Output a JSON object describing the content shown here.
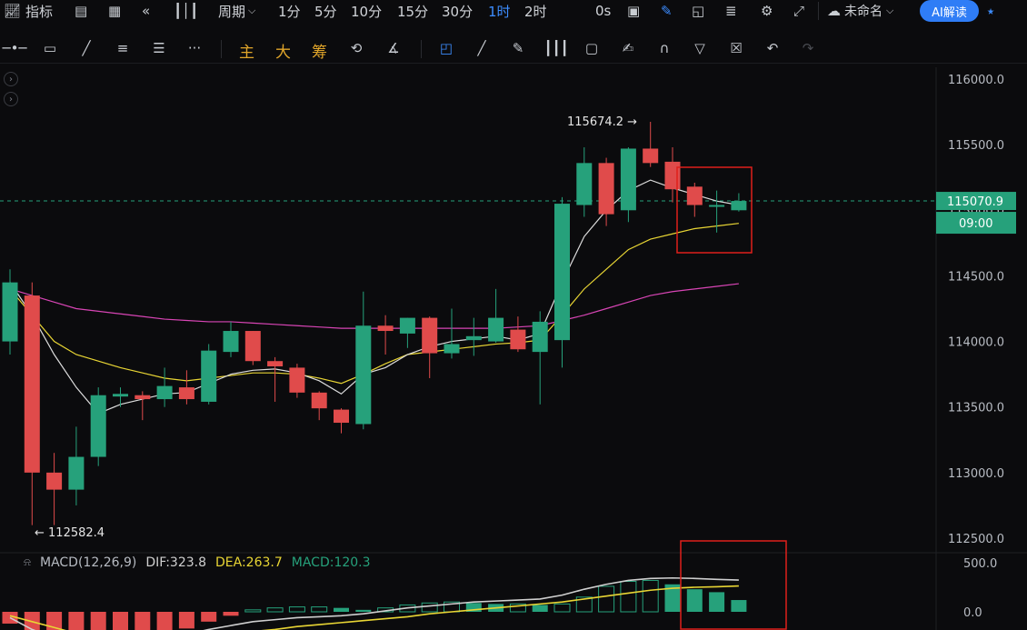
{
  "top_toolbar": {
    "indicators_label": "指标",
    "period_label": "周期",
    "intervals": [
      "1分",
      "5分",
      "10分",
      "15分",
      "30分",
      "1时",
      "2时"
    ],
    "active_interval": "1时",
    "countdown": "0s",
    "layout_name": "未命名",
    "ai_button": "AI解读"
  },
  "draw_toolbar": {
    "overlay_buttons": [
      "主",
      "大",
      "筹"
    ]
  },
  "price_panel": {
    "current_price": "115070.9",
    "countdown_time": "09:00",
    "high_marker": "115674.2",
    "low_marker": "112582.4",
    "colors": {
      "up": "#26a17b",
      "down": "#e04b4b",
      "ma_short": "#dddddd",
      "ma_mid": "#e8d534",
      "ma_long": "#d845b5",
      "price_line": "#26a17b",
      "highlight_box": "#e0201b"
    }
  },
  "macd_panel": {
    "name": "MACD(12,26,9)",
    "dif_label": "DIF:323.8",
    "dea_label": "DEA:263.7",
    "macd_label": "MACD:120.3",
    "colors": {
      "dif": "#cfcfcf",
      "dea": "#e8d534",
      "macd_label": "#26a17b"
    }
  },
  "chart_data": {
    "type": "candlestick",
    "ylim": [
      112300,
      116200
    ],
    "y_ticks": [
      "116000.0",
      "115500.0",
      "115000.0",
      "114500.0",
      "114000.0",
      "113500.0",
      "113000.0",
      "112500.0"
    ],
    "candles": [
      {
        "o": 114000,
        "h": 114550,
        "l": 113900,
        "c": 114450
      },
      {
        "o": 114350,
        "h": 114450,
        "l": 112600,
        "c": 113000
      },
      {
        "o": 113000,
        "h": 113150,
        "l": 112600,
        "c": 112870
      },
      {
        "o": 112870,
        "h": 113350,
        "l": 112750,
        "c": 113120
      },
      {
        "o": 113120,
        "h": 113650,
        "l": 113050,
        "c": 113590
      },
      {
        "o": 113580,
        "h": 113650,
        "l": 113500,
        "c": 113600
      },
      {
        "o": 113590,
        "h": 113620,
        "l": 113400,
        "c": 113560
      },
      {
        "o": 113560,
        "h": 113800,
        "l": 113500,
        "c": 113660
      },
      {
        "o": 113650,
        "h": 113780,
        "l": 113520,
        "c": 113560
      },
      {
        "o": 113540,
        "h": 113980,
        "l": 113520,
        "c": 113930
      },
      {
        "o": 113920,
        "h": 114150,
        "l": 113880,
        "c": 114080
      },
      {
        "o": 114080,
        "h": 114080,
        "l": 113820,
        "c": 113850
      },
      {
        "o": 113850,
        "h": 113880,
        "l": 113540,
        "c": 113810
      },
      {
        "o": 113800,
        "h": 113830,
        "l": 113570,
        "c": 113610
      },
      {
        "o": 113610,
        "h": 113620,
        "l": 113400,
        "c": 113490
      },
      {
        "o": 113480,
        "h": 113490,
        "l": 113300,
        "c": 113380
      },
      {
        "o": 113370,
        "h": 114380,
        "l": 113330,
        "c": 114120
      },
      {
        "o": 114120,
        "h": 114200,
        "l": 113900,
        "c": 114080
      },
      {
        "o": 114060,
        "h": 114180,
        "l": 113950,
        "c": 114180
      },
      {
        "o": 114180,
        "h": 114190,
        "l": 113720,
        "c": 113910
      },
      {
        "o": 113910,
        "h": 114250,
        "l": 113870,
        "c": 113980
      },
      {
        "o": 114010,
        "h": 114180,
        "l": 113890,
        "c": 114040
      },
      {
        "o": 114000,
        "h": 114400,
        "l": 113990,
        "c": 114180
      },
      {
        "o": 114090,
        "h": 114190,
        "l": 113920,
        "c": 113940
      },
      {
        "o": 113920,
        "h": 114230,
        "l": 113520,
        "c": 114150
      },
      {
        "o": 114010,
        "h": 115100,
        "l": 113800,
        "c": 115050
      },
      {
        "o": 115040,
        "h": 115480,
        "l": 114950,
        "c": 115360
      },
      {
        "o": 115360,
        "h": 115400,
        "l": 114880,
        "c": 114970
      },
      {
        "o": 115000,
        "h": 115480,
        "l": 114910,
        "c": 115470
      },
      {
        "o": 115470,
        "h": 115674.2,
        "l": 115330,
        "c": 115360
      },
      {
        "o": 115370,
        "h": 115480,
        "l": 115060,
        "c": 115160
      },
      {
        "o": 115180,
        "h": 115210,
        "l": 114950,
        "c": 115040
      },
      {
        "o": 115030,
        "h": 115150,
        "l": 114830,
        "c": 115040
      },
      {
        "o": 115000,
        "h": 115130,
        "l": 114990,
        "c": 115070.9
      }
    ],
    "ma_short": [
      114450,
      114200,
      113900,
      113650,
      113450,
      113520,
      113560,
      113600,
      113610,
      113680,
      113750,
      113780,
      113790,
      113760,
      113700,
      113600,
      113750,
      113800,
      113900,
      113960,
      114000,
      114020,
      114040,
      114010,
      114060,
      114450,
      114800,
      115000,
      115150,
      115230,
      115170,
      115120,
      115070,
      115040
    ],
    "ma_mid": [
      114400,
      114200,
      114000,
      113900,
      113850,
      113800,
      113760,
      113720,
      113700,
      113720,
      113740,
      113760,
      113760,
      113750,
      113720,
      113680,
      113750,
      113830,
      113900,
      113920,
      113940,
      113960,
      113980,
      113990,
      114010,
      114200,
      114400,
      114550,
      114700,
      114780,
      114820,
      114860,
      114880,
      114900
    ],
    "ma_long": [
      114400,
      114350,
      114300,
      114250,
      114230,
      114210,
      114190,
      114170,
      114160,
      114150,
      114150,
      114140,
      114130,
      114120,
      114110,
      114100,
      114100,
      114100,
      114100,
      114100,
      114100,
      114100,
      114100,
      114110,
      114120,
      114160,
      114200,
      114250,
      114300,
      114350,
      114380,
      114400,
      114420,
      114440
    ],
    "macd_ylim": [
      -150,
      560
    ],
    "macd_ticks": [
      "500.0",
      "0.0"
    ],
    "macd_hist": [
      -120,
      -240,
      -320,
      -380,
      -390,
      -350,
      -290,
      -230,
      -170,
      -100,
      -40,
      20,
      40,
      50,
      50,
      40,
      20,
      40,
      70,
      90,
      100,
      90,
      80,
      80,
      70,
      80,
      150,
      260,
      310,
      320,
      280,
      230,
      200,
      120
    ],
    "dif": [
      -60,
      -180,
      -260,
      -330,
      -360,
      -340,
      -310,
      -270,
      -230,
      -180,
      -140,
      -100,
      -80,
      -60,
      -50,
      -40,
      -20,
      10,
      40,
      60,
      80,
      100,
      110,
      120,
      130,
      170,
      230,
      280,
      320,
      340,
      345,
      340,
      330,
      323.8
    ],
    "dea": [
      -40,
      -100,
      -160,
      -220,
      -260,
      -280,
      -290,
      -280,
      -270,
      -250,
      -230,
      -200,
      -180,
      -150,
      -130,
      -110,
      -90,
      -70,
      -50,
      -20,
      0,
      20,
      40,
      60,
      80,
      100,
      130,
      160,
      190,
      220,
      240,
      250,
      255,
      263.7
    ]
  }
}
